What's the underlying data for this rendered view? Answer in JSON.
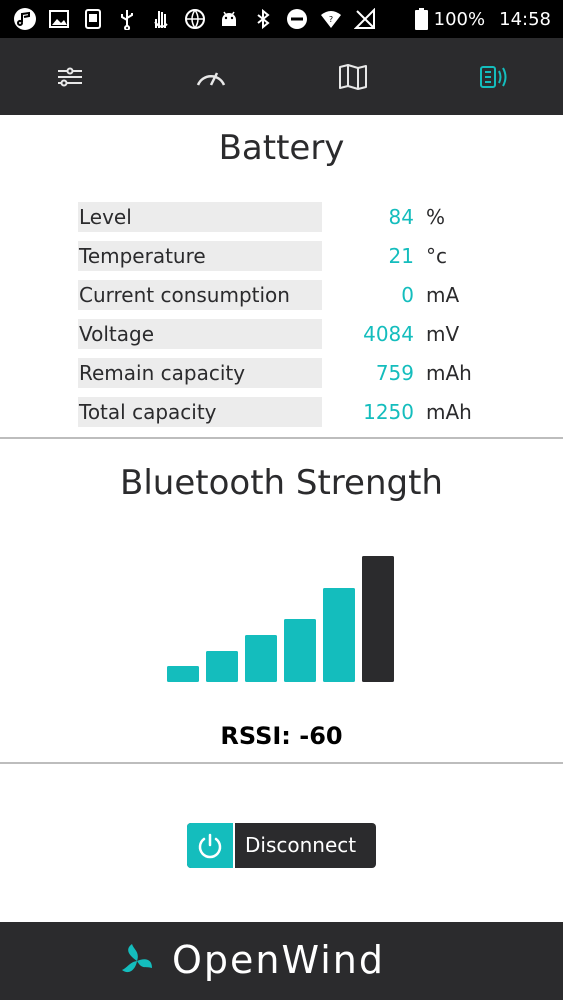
{
  "status_bar": {
    "battery_percent": "100%",
    "time": "14:58"
  },
  "nav": {
    "tabs": [
      {
        "icon": "sliders-icon",
        "active": false
      },
      {
        "icon": "gauge-icon",
        "active": false
      },
      {
        "icon": "map-icon",
        "active": false
      },
      {
        "icon": "device-signal-icon",
        "active": true
      }
    ]
  },
  "battery": {
    "title": "Battery",
    "rows": [
      {
        "label": "Level",
        "value": "84",
        "unit": "%"
      },
      {
        "label": "Temperature",
        "value": "21",
        "unit": "°c"
      },
      {
        "label": "Current consumption",
        "value": "0",
        "unit": "mA"
      },
      {
        "label": "Voltage",
        "value": "4084",
        "unit": "mV"
      },
      {
        "label": "Remain capacity",
        "value": "759",
        "unit": "mAh"
      },
      {
        "label": "Total capacity",
        "value": "1250",
        "unit": "mAh"
      }
    ]
  },
  "bluetooth": {
    "title": "Bluetooth Strength",
    "level": 5,
    "max_level": 6,
    "rssi_text": "RSSI: -60"
  },
  "actions": {
    "disconnect_label": "Disconnect"
  },
  "footer": {
    "brand": "OpenWind"
  },
  "colors": {
    "accent": "#14bdbd",
    "dark": "#2b2b2d",
    "row_bg": "#ececec"
  }
}
